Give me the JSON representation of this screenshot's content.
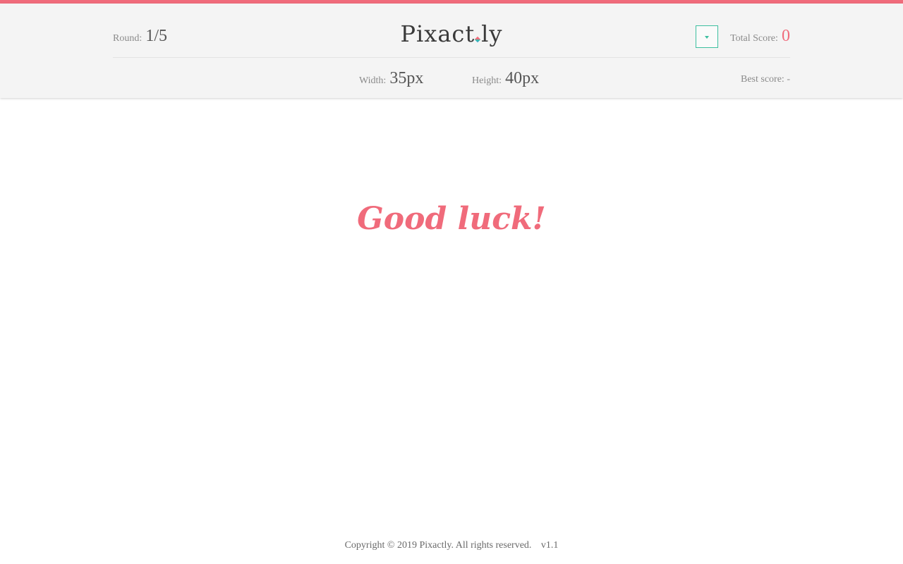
{
  "header": {
    "round_label": "Round:",
    "round_value": "1/5",
    "logo_left": "Pixact",
    "logo_right": "ly",
    "total_score_label": "Total Score:",
    "total_score_value": "0",
    "width_label": "Width:",
    "width_value": "35px",
    "height_label": "Height:",
    "height_value": "40px",
    "best_score_label": "Best score:",
    "best_score_value": "-",
    "menu_icon": "chevron-down-icon"
  },
  "main": {
    "message": "Good luck!"
  },
  "footer": {
    "copyright": "Copyright © 2019 Pixactly. All rights reserved.",
    "version": "v1.1"
  },
  "colors": {
    "accent": "#f06b7b",
    "secondary": "#3dbfa0",
    "header_bg": "#f4f4f4"
  }
}
